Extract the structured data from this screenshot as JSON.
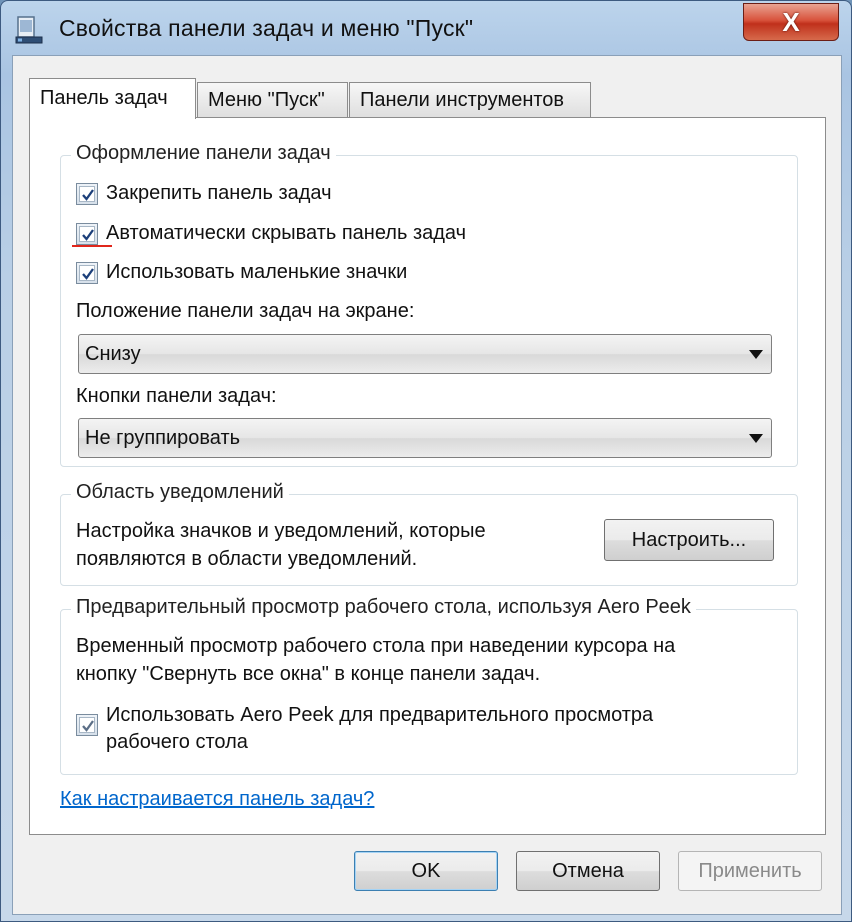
{
  "window": {
    "title": "Свойства панели задач и меню \"Пуск\"",
    "close_label": "X"
  },
  "tabs": [
    {
      "label": "Панель задач",
      "active": true
    },
    {
      "label": "Меню \"Пуск\"",
      "active": false
    },
    {
      "label": "Панели инструментов",
      "active": false
    }
  ],
  "appearance": {
    "title": "Оформление панели задач",
    "checkboxes": [
      {
        "label": "Закрепить панель задач",
        "checked": true
      },
      {
        "label": "Автоматически скрывать панель задач",
        "checked": true
      },
      {
        "label": "Использовать маленькие значки",
        "checked": true
      }
    ],
    "position_label": "Положение панели задач на экране:",
    "position_value": "Снизу",
    "buttons_label": "Кнопки панели задач:",
    "buttons_value": "Не группировать"
  },
  "notification": {
    "title": "Область уведомлений",
    "description_line1": "Настройка значков и уведомлений, которые",
    "description_line2": "появляются в области уведомлений.",
    "customize_button": "Настроить..."
  },
  "aero_peek": {
    "title": "Предварительный просмотр рабочего стола, используя Aero Peek",
    "description_line1": "Временный просмотр рабочего стола при наведении курсора на",
    "description_line2": "кнопку \"Свернуть все окна\" в конце панели задач.",
    "checkbox_line1": "Использовать Aero Peek для предварительного просмотра",
    "checkbox_line2": "рабочего стола",
    "checkbox_checked": true
  },
  "help_link": "Как настраивается панель задач?",
  "footer": {
    "ok": "OK",
    "cancel": "Отмена",
    "apply": "Применить"
  },
  "colors": {
    "link": "#0066cc",
    "highlight": "#e0261b"
  }
}
